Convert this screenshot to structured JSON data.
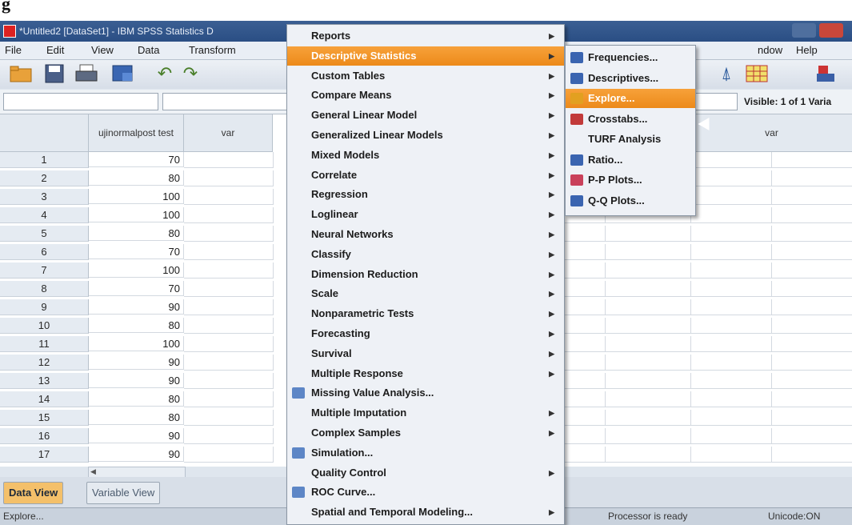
{
  "caption": "g",
  "window": {
    "title": "*Untitled2 [DataSet1] - IBM SPSS Statistics D"
  },
  "menubar": {
    "items": [
      "File",
      "Edit",
      "View",
      "Data",
      "Transform"
    ],
    "right_items": [
      "ndow",
      "Help"
    ]
  },
  "cellbar": {
    "visible_text": "Visible: 1 of 1 Varia"
  },
  "grid": {
    "columns": [
      "ujinormalpost test",
      "var",
      "var",
      "var"
    ],
    "rows": [
      {
        "n": "1",
        "v": "70"
      },
      {
        "n": "2",
        "v": "80"
      },
      {
        "n": "3",
        "v": "100"
      },
      {
        "n": "4",
        "v": "100"
      },
      {
        "n": "5",
        "v": "80"
      },
      {
        "n": "6",
        "v": "70"
      },
      {
        "n": "7",
        "v": "100"
      },
      {
        "n": "8",
        "v": "70"
      },
      {
        "n": "9",
        "v": "90"
      },
      {
        "n": "10",
        "v": "80"
      },
      {
        "n": "11",
        "v": "100"
      },
      {
        "n": "12",
        "v": "90"
      },
      {
        "n": "13",
        "v": "90"
      },
      {
        "n": "14",
        "v": "80"
      },
      {
        "n": "15",
        "v": "80"
      },
      {
        "n": "16",
        "v": "90"
      },
      {
        "n": "17",
        "v": "90"
      }
    ]
  },
  "tabs": {
    "data_view": "Data View",
    "variable_view": "Variable View"
  },
  "statusbar": {
    "left": "Explore...",
    "processor": "Processor is ready",
    "unicode": "Unicode:ON"
  },
  "analyze_menu": {
    "items": [
      {
        "label": "Reports",
        "arrow": true,
        "icon": "none"
      },
      {
        "label": "Descriptive Statistics",
        "arrow": true,
        "icon": "none",
        "highlighted": true
      },
      {
        "label": "Custom Tables",
        "arrow": true,
        "icon": "none"
      },
      {
        "label": "Compare Means",
        "arrow": true,
        "icon": "none"
      },
      {
        "label": "General Linear Model",
        "arrow": true,
        "icon": "none"
      },
      {
        "label": "Generalized Linear Models",
        "arrow": true,
        "icon": "none"
      },
      {
        "label": "Mixed Models",
        "arrow": true,
        "icon": "none"
      },
      {
        "label": "Correlate",
        "arrow": true,
        "icon": "none"
      },
      {
        "label": "Regression",
        "arrow": true,
        "icon": "none"
      },
      {
        "label": "Loglinear",
        "arrow": true,
        "icon": "none"
      },
      {
        "label": "Neural Networks",
        "arrow": true,
        "icon": "none"
      },
      {
        "label": "Classify",
        "arrow": true,
        "icon": "none"
      },
      {
        "label": "Dimension Reduction",
        "arrow": true,
        "icon": "none"
      },
      {
        "label": "Scale",
        "arrow": true,
        "icon": "none"
      },
      {
        "label": "Nonparametric Tests",
        "arrow": true,
        "icon": "none"
      },
      {
        "label": "Forecasting",
        "arrow": true,
        "icon": "none"
      },
      {
        "label": "Survival",
        "arrow": true,
        "icon": "none"
      },
      {
        "label": "Multiple Response",
        "arrow": true,
        "icon": "none"
      },
      {
        "label": "Missing Value Analysis...",
        "arrow": false,
        "icon": "missing-value-icon"
      },
      {
        "label": "Multiple Imputation",
        "arrow": true,
        "icon": "none"
      },
      {
        "label": "Complex Samples",
        "arrow": true,
        "icon": "none"
      },
      {
        "label": "Simulation...",
        "arrow": false,
        "icon": "simulation-icon"
      },
      {
        "label": "Quality Control",
        "arrow": true,
        "icon": "none"
      },
      {
        "label": "ROC Curve...",
        "arrow": false,
        "icon": "roc-curve-icon"
      },
      {
        "label": "Spatial and Temporal Modeling...",
        "arrow": true,
        "icon": "none"
      }
    ]
  },
  "descriptive_submenu": {
    "items": [
      {
        "label": "Frequencies...",
        "icon": "frequencies-icon"
      },
      {
        "label": "Descriptives...",
        "icon": "descriptives-icon"
      },
      {
        "label": "Explore...",
        "icon": "explore-icon",
        "highlighted": true
      },
      {
        "label": "Crosstabs...",
        "icon": "crosstabs-icon"
      },
      {
        "label": "TURF Analysis",
        "icon": "none"
      },
      {
        "label": "Ratio...",
        "icon": "ratio-icon"
      },
      {
        "label": "P-P Plots...",
        "icon": "pp-plots-icon"
      },
      {
        "label": "Q-Q Plots...",
        "icon": "qq-plots-icon"
      }
    ]
  },
  "colors": {
    "highlight": "#ef9324",
    "titlebar": "#2a4e84",
    "active_tab": "#f4c06a"
  }
}
